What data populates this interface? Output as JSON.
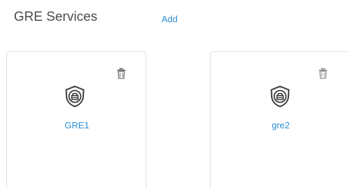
{
  "header": {
    "title": "GRE Services",
    "add_label": "Add"
  },
  "services": [
    {
      "name": "GRE1",
      "icon": "shield-lock-icon",
      "delete_icon": "trash-icon"
    },
    {
      "name": "gre2",
      "icon": "shield-lock-icon",
      "delete_icon": "trash-icon"
    }
  ],
  "colors": {
    "accent": "#2d8fd5",
    "title_text": "#4a4a4a",
    "card_border": "#e0e0e0",
    "icon_dark": "#3a3a3a"
  }
}
